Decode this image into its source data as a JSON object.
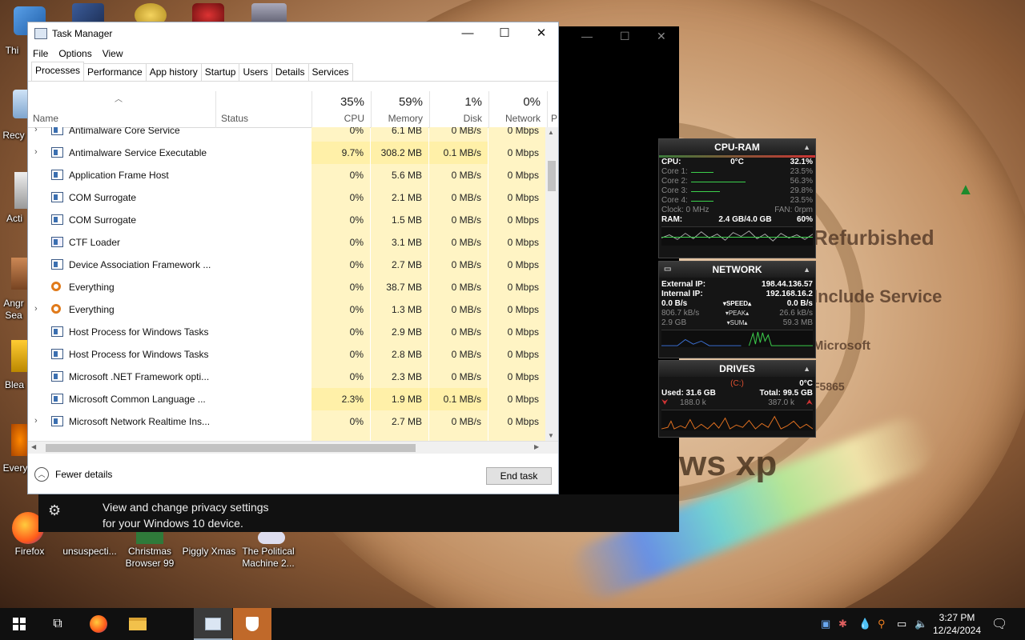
{
  "desktop": {
    "icons": [
      {
        "label": "Thi"
      },
      {
        "label": "Recy"
      },
      {
        "label": "Acti"
      },
      {
        "label": "Angr Sea"
      },
      {
        "label": "Blea"
      },
      {
        "label": "Every"
      },
      {
        "label": "Firefox"
      },
      {
        "label": "unsuspecti..."
      },
      {
        "label": "Christmas Browser 99"
      },
      {
        "label": "Piggly Xmas"
      },
      {
        "label": "The Political Machine 2..."
      }
    ],
    "wallpaper_text": {
      "refurb": "Refurbished",
      "service": "Include Service",
      "micro": "Microsoft",
      "code": "F5865",
      "xp": "ws xp"
    }
  },
  "task_manager": {
    "title": "Task Manager",
    "menu": [
      "File",
      "Options",
      "View"
    ],
    "tabs": [
      "Processes",
      "Performance",
      "App history",
      "Startup",
      "Users",
      "Details",
      "Services"
    ],
    "active_tab": "Processes",
    "columns": {
      "name": "Name",
      "status": "Status",
      "cpu": {
        "pct": "35%",
        "label": "CPU"
      },
      "memory": {
        "pct": "59%",
        "label": "Memory"
      },
      "disk": {
        "pct": "1%",
        "label": "Disk"
      },
      "network": {
        "pct": "0%",
        "label": "Network"
      },
      "power": "P"
    },
    "rows": [
      {
        "name": "Antimalware Core Service",
        "cpu": "0%",
        "mem": "6.1 MB",
        "disk": "0 MB/s",
        "net": "0 Mbps",
        "expand": true
      },
      {
        "name": "Antimalware Service Executable",
        "cpu": "9.7%",
        "mem": "308.2 MB",
        "disk": "0.1 MB/s",
        "net": "0 Mbps",
        "expand": true
      },
      {
        "name": "Application Frame Host",
        "cpu": "0%",
        "mem": "5.6 MB",
        "disk": "0 MB/s",
        "net": "0 Mbps",
        "expand": false
      },
      {
        "name": "COM Surrogate",
        "cpu": "0%",
        "mem": "2.1 MB",
        "disk": "0 MB/s",
        "net": "0 Mbps",
        "expand": false
      },
      {
        "name": "COM Surrogate",
        "cpu": "0%",
        "mem": "1.5 MB",
        "disk": "0 MB/s",
        "net": "0 Mbps",
        "expand": false
      },
      {
        "name": "CTF Loader",
        "cpu": "0%",
        "mem": "3.1 MB",
        "disk": "0 MB/s",
        "net": "0 Mbps",
        "expand": false
      },
      {
        "name": "Device Association Framework ...",
        "cpu": "0%",
        "mem": "2.7 MB",
        "disk": "0 MB/s",
        "net": "0 Mbps",
        "expand": false
      },
      {
        "name": "Everything",
        "cpu": "0%",
        "mem": "38.7 MB",
        "disk": "0 MB/s",
        "net": "0 Mbps",
        "expand": false
      },
      {
        "name": "Everything",
        "cpu": "0%",
        "mem": "1.3 MB",
        "disk": "0 MB/s",
        "net": "0 Mbps",
        "expand": true
      },
      {
        "name": "Host Process for Windows Tasks",
        "cpu": "0%",
        "mem": "2.9 MB",
        "disk": "0 MB/s",
        "net": "0 Mbps",
        "expand": false
      },
      {
        "name": "Host Process for Windows Tasks",
        "cpu": "0%",
        "mem": "2.8 MB",
        "disk": "0 MB/s",
        "net": "0 Mbps",
        "expand": false
      },
      {
        "name": "Microsoft .NET Framework opti...",
        "cpu": "0%",
        "mem": "2.3 MB",
        "disk": "0 MB/s",
        "net": "0 Mbps",
        "expand": false
      },
      {
        "name": "Microsoft Common Language ...",
        "cpu": "2.3%",
        "mem": "1.9 MB",
        "disk": "0.1 MB/s",
        "net": "0 Mbps",
        "expand": false
      },
      {
        "name": "Microsoft Network Realtime Ins...",
        "cpu": "0%",
        "mem": "2.7 MB",
        "disk": "0 MB/s",
        "net": "0 Mbps",
        "expand": true
      }
    ],
    "footer": {
      "fewer": "Fewer details",
      "end_task": "End task"
    }
  },
  "notification": {
    "line1": "View and change privacy settings",
    "line2": "for your Windows 10 device."
  },
  "gadgets": {
    "cpu_ram": {
      "title": "CPU-RAM",
      "cpu_label": "CPU:",
      "temp": "0°C",
      "cpu_pct": "32.1%",
      "cores": [
        {
          "label": "Core 1:",
          "value": "23.5%",
          "level": 0.235
        },
        {
          "label": "Core 2:",
          "value": "56.3%",
          "level": 0.563
        },
        {
          "label": "Core 3:",
          "value": "29.8%",
          "level": 0.298
        },
        {
          "label": "Core 4:",
          "value": "23.5%",
          "level": 0.235
        }
      ],
      "clock": "Clock: 0 MHz",
      "fan": "FAN: 0rpm",
      "ram_label": "RAM:",
      "ram_used": "2.4 GB/4.0 GB",
      "ram_pct": "60%"
    },
    "network": {
      "title": "NETWORK",
      "external_label": "External IP:",
      "external_ip": "198.44.136.57",
      "internal_label": "Internal IP:",
      "internal_ip": "192.168.16.2",
      "speed_down": "0.0 B/s",
      "speed_label": "SPEED",
      "speed_up": "0.0 B/s",
      "peak_down": "806.7 kB/s",
      "peak_label": "PEAK",
      "peak_up": "26.6 kB/s",
      "sum_down": "2.9 GB",
      "sum_label": "SUM",
      "sum_up": "59.3 MB"
    },
    "drives": {
      "title": "DRIVES",
      "drive": "(C:)",
      "temp": "0°C",
      "used": "Used: 31.6 GB",
      "total": "Total: 99.5 GB",
      "read": "188.0 k",
      "write": "387.0 k"
    }
  },
  "taskbar": {
    "time": "3:27 PM",
    "date": "12/24/2024"
  }
}
